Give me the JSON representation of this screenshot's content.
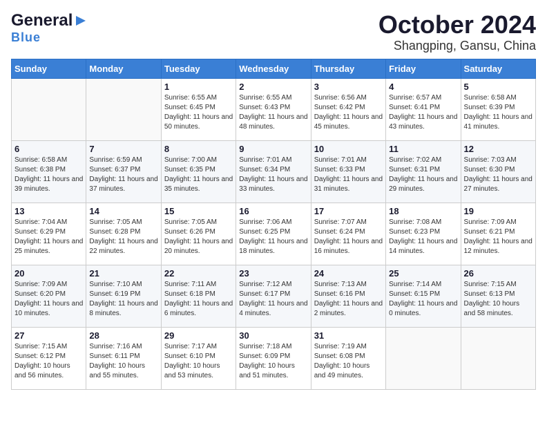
{
  "logo": {
    "general": "General",
    "blue": "Blue"
  },
  "title": "October 2024",
  "location": "Shangping, Gansu, China",
  "weekdays": [
    "Sunday",
    "Monday",
    "Tuesday",
    "Wednesday",
    "Thursday",
    "Friday",
    "Saturday"
  ],
  "weeks": [
    [
      {
        "day": "",
        "info": ""
      },
      {
        "day": "",
        "info": ""
      },
      {
        "day": "1",
        "sunrise": "6:55 AM",
        "sunset": "6:45 PM",
        "daylight": "11 hours and 50 minutes."
      },
      {
        "day": "2",
        "sunrise": "6:55 AM",
        "sunset": "6:43 PM",
        "daylight": "11 hours and 48 minutes."
      },
      {
        "day": "3",
        "sunrise": "6:56 AM",
        "sunset": "6:42 PM",
        "daylight": "11 hours and 45 minutes."
      },
      {
        "day": "4",
        "sunrise": "6:57 AM",
        "sunset": "6:41 PM",
        "daylight": "11 hours and 43 minutes."
      },
      {
        "day": "5",
        "sunrise": "6:58 AM",
        "sunset": "6:39 PM",
        "daylight": "11 hours and 41 minutes."
      }
    ],
    [
      {
        "day": "6",
        "sunrise": "6:58 AM",
        "sunset": "6:38 PM",
        "daylight": "11 hours and 39 minutes."
      },
      {
        "day": "7",
        "sunrise": "6:59 AM",
        "sunset": "6:37 PM",
        "daylight": "11 hours and 37 minutes."
      },
      {
        "day": "8",
        "sunrise": "7:00 AM",
        "sunset": "6:35 PM",
        "daylight": "11 hours and 35 minutes."
      },
      {
        "day": "9",
        "sunrise": "7:01 AM",
        "sunset": "6:34 PM",
        "daylight": "11 hours and 33 minutes."
      },
      {
        "day": "10",
        "sunrise": "7:01 AM",
        "sunset": "6:33 PM",
        "daylight": "11 hours and 31 minutes."
      },
      {
        "day": "11",
        "sunrise": "7:02 AM",
        "sunset": "6:31 PM",
        "daylight": "11 hours and 29 minutes."
      },
      {
        "day": "12",
        "sunrise": "7:03 AM",
        "sunset": "6:30 PM",
        "daylight": "11 hours and 27 minutes."
      }
    ],
    [
      {
        "day": "13",
        "sunrise": "7:04 AM",
        "sunset": "6:29 PM",
        "daylight": "11 hours and 25 minutes."
      },
      {
        "day": "14",
        "sunrise": "7:05 AM",
        "sunset": "6:28 PM",
        "daylight": "11 hours and 22 minutes."
      },
      {
        "day": "15",
        "sunrise": "7:05 AM",
        "sunset": "6:26 PM",
        "daylight": "11 hours and 20 minutes."
      },
      {
        "day": "16",
        "sunrise": "7:06 AM",
        "sunset": "6:25 PM",
        "daylight": "11 hours and 18 minutes."
      },
      {
        "day": "17",
        "sunrise": "7:07 AM",
        "sunset": "6:24 PM",
        "daylight": "11 hours and 16 minutes."
      },
      {
        "day": "18",
        "sunrise": "7:08 AM",
        "sunset": "6:23 PM",
        "daylight": "11 hours and 14 minutes."
      },
      {
        "day": "19",
        "sunrise": "7:09 AM",
        "sunset": "6:21 PM",
        "daylight": "11 hours and 12 minutes."
      }
    ],
    [
      {
        "day": "20",
        "sunrise": "7:09 AM",
        "sunset": "6:20 PM",
        "daylight": "11 hours and 10 minutes."
      },
      {
        "day": "21",
        "sunrise": "7:10 AM",
        "sunset": "6:19 PM",
        "daylight": "11 hours and 8 minutes."
      },
      {
        "day": "22",
        "sunrise": "7:11 AM",
        "sunset": "6:18 PM",
        "daylight": "11 hours and 6 minutes."
      },
      {
        "day": "23",
        "sunrise": "7:12 AM",
        "sunset": "6:17 PM",
        "daylight": "11 hours and 4 minutes."
      },
      {
        "day": "24",
        "sunrise": "7:13 AM",
        "sunset": "6:16 PM",
        "daylight": "11 hours and 2 minutes."
      },
      {
        "day": "25",
        "sunrise": "7:14 AM",
        "sunset": "6:15 PM",
        "daylight": "11 hours and 0 minutes."
      },
      {
        "day": "26",
        "sunrise": "7:15 AM",
        "sunset": "6:13 PM",
        "daylight": "10 hours and 58 minutes."
      }
    ],
    [
      {
        "day": "27",
        "sunrise": "7:15 AM",
        "sunset": "6:12 PM",
        "daylight": "10 hours and 56 minutes."
      },
      {
        "day": "28",
        "sunrise": "7:16 AM",
        "sunset": "6:11 PM",
        "daylight": "10 hours and 55 minutes."
      },
      {
        "day": "29",
        "sunrise": "7:17 AM",
        "sunset": "6:10 PM",
        "daylight": "10 hours and 53 minutes."
      },
      {
        "day": "30",
        "sunrise": "7:18 AM",
        "sunset": "6:09 PM",
        "daylight": "10 hours and 51 minutes."
      },
      {
        "day": "31",
        "sunrise": "7:19 AM",
        "sunset": "6:08 PM",
        "daylight": "10 hours and 49 minutes."
      },
      {
        "day": "",
        "info": ""
      },
      {
        "day": "",
        "info": ""
      }
    ]
  ]
}
